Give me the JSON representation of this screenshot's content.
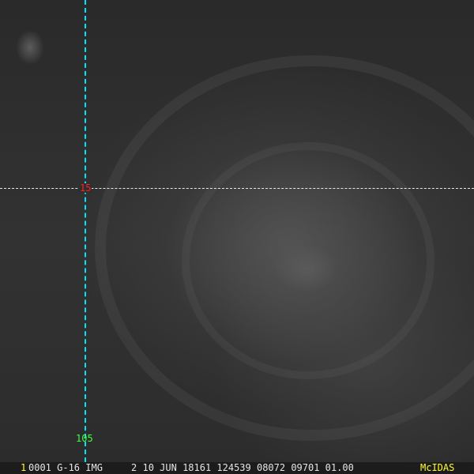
{
  "overlay": {
    "latitude_label": "15",
    "longitude_label": "105",
    "latitude_line_color": "#e8e8e8",
    "longitude_line_color": "#00e5ff"
  },
  "status_bar": {
    "frame_number": "1",
    "info": "0001 G-16 IMG     2 10 JUN 18161 124539 08072 09701 01.00",
    "brand": "McIDAS"
  }
}
